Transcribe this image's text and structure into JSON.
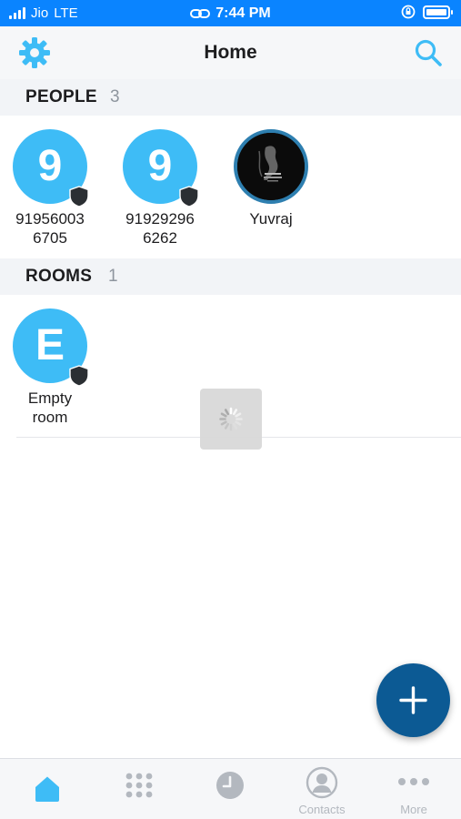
{
  "status_bar": {
    "carrier": "Jio",
    "network": "LTE",
    "time": "7:44 PM"
  },
  "header": {
    "title": "Home",
    "settings_icon": "gear-icon",
    "search_icon": "search-icon"
  },
  "people": {
    "title": "PEOPLE",
    "count": "3",
    "items": [
      {
        "initial": "9",
        "name_line1": "91956003",
        "name_line2": "6705",
        "badge": "shield-icon"
      },
      {
        "initial": "9",
        "name_line1": "91929296",
        "name_line2": "6262",
        "badge": "shield-icon"
      },
      {
        "name_line1": "Yuvraj",
        "avatar": "photo"
      }
    ]
  },
  "rooms": {
    "title": "ROOMS",
    "count": "1",
    "items": [
      {
        "initial": "E",
        "name_line1": "Empty",
        "name_line2": "room",
        "badge": "shield-icon"
      }
    ]
  },
  "fab": {
    "icon": "plus-icon"
  },
  "tab_bar": {
    "tabs": [
      {
        "icon": "home-icon",
        "label": "",
        "active": true
      },
      {
        "icon": "dialpad-icon",
        "label": ""
      },
      {
        "icon": "clock-icon",
        "label": ""
      },
      {
        "icon": "contacts-icon",
        "label": "Contacts"
      },
      {
        "icon": "more-icon",
        "label": "More"
      }
    ]
  },
  "colors": {
    "accent": "#3ebcf6",
    "status_bar": "#0a84ff",
    "fab": "#0c5a94",
    "inactive_tab": "#b3b8bf"
  }
}
